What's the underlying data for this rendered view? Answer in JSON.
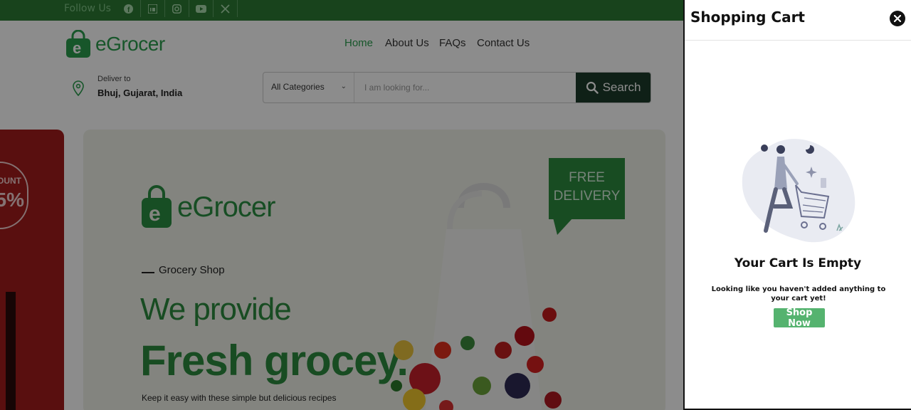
{
  "topbar": {
    "follow_label": "Follow Us",
    "social_icons": [
      "facebook-icon",
      "linkedin-icon",
      "instagram-icon",
      "youtube-icon",
      "x-icon"
    ]
  },
  "header": {
    "logo_text": "eGrocer",
    "nav": [
      "Home",
      "About Us",
      "FAQs",
      "Contact Us"
    ],
    "deliver_label": "Deliver to",
    "deliver_location": "Bhuj, Gujarat, India",
    "category_selected": "All Categories",
    "search_placeholder": "I am looking for...",
    "search_button": "Search"
  },
  "banner_left": {
    "discount_text": "OUNT",
    "discount_value": "5%"
  },
  "banner": {
    "logo_text": "eGrocer",
    "tag": "Grocery Shop",
    "headline_1": "We provide",
    "headline_2": "Fresh grocey.",
    "paragraph": "Keep it easy with these simple but delicious recipes",
    "free_line1": "FREE",
    "free_line2": "DELIVERY"
  },
  "cart": {
    "title": "Shopping Cart",
    "empty_title": "Your Cart Is Empty",
    "empty_message": "Looking like you haven't added anything to your cart yet!",
    "shop_now": "Shop Now"
  },
  "colors": {
    "brand_green": "#2d7a33",
    "search_button": "#1d3b2a",
    "shop_now": "#55b36f"
  }
}
